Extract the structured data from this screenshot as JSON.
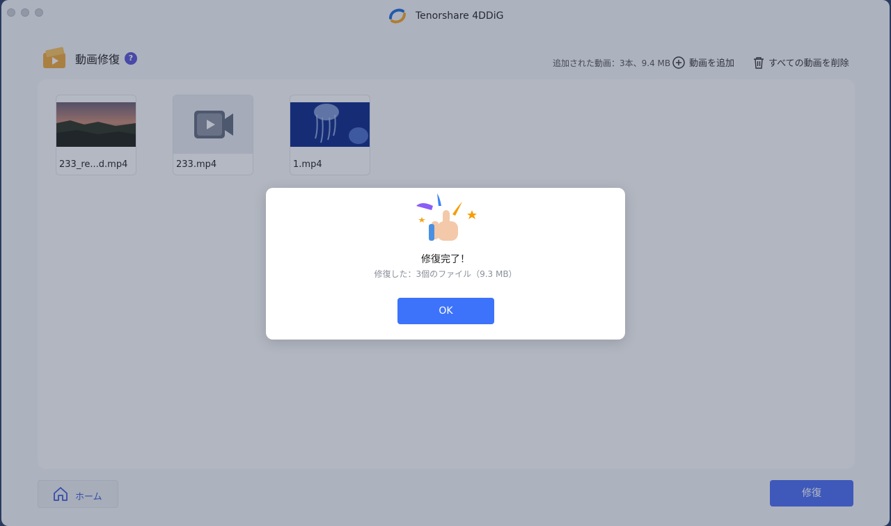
{
  "window": {
    "title": "Tenorshare 4DDiG"
  },
  "header": {
    "section_title": "動画修復",
    "help_icon": "?",
    "stats": "追加された動画：3本、9.4 MB",
    "add_label": "動画を追加",
    "delete_all_label": "すべての動画を削除"
  },
  "files": [
    {
      "name": "233_re...d.mp4",
      "thumb": "sunset-landscape"
    },
    {
      "name": "233.mp4",
      "thumb": "video-placeholder-icon"
    },
    {
      "name": "1.mp4",
      "thumb": "jellyfish"
    }
  ],
  "footer": {
    "home_label": "ホーム",
    "repair_label": "修復"
  },
  "dialog": {
    "title": "修復完了！",
    "subtitle": "修復した：3個のファイル（9.3 MB）",
    "ok_label": "OK"
  },
  "colors": {
    "accent": "#3d73fa",
    "help_badge": "#5b55d6"
  }
}
